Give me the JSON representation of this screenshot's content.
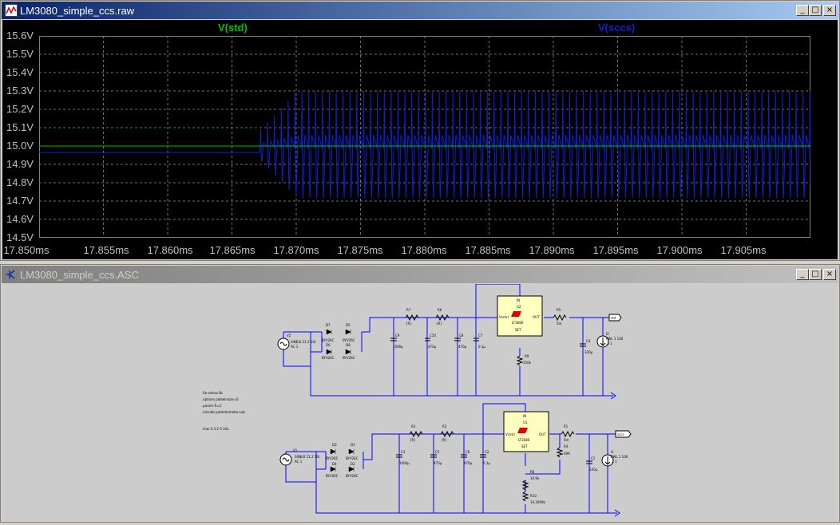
{
  "waveform_window": {
    "title": "LM3080_simple_ccs.raw",
    "traces": [
      {
        "name": "V(std)",
        "color": "#00c000"
      },
      {
        "name": "V(sccs)",
        "color": "#1020d0"
      }
    ],
    "y_ticks": [
      "15.6V",
      "15.5V",
      "15.4V",
      "15.3V",
      "15.2V",
      "15.1V",
      "15.0V",
      "14.9V",
      "14.8V",
      "14.7V",
      "14.6V",
      "14.5V"
    ],
    "x_ticks": [
      "17.850ms",
      "17.855ms",
      "17.860ms",
      "17.865ms",
      "17.870ms",
      "17.875ms",
      "17.880ms",
      "17.885ms",
      "17.890ms",
      "17.895ms",
      "17.900ms",
      "17.905ms"
    ]
  },
  "schematic_window": {
    "title": "LM3080_simple_ccs.ASC",
    "directives": [
      ".lib extras.lib",
      ".options plotwinsize=0",
      ".param R=2",
      ".include potentiometer.sub",
      ".tran 0 3.2 0 10u"
    ],
    "top": {
      "source": {
        "ref": "V2",
        "value1": "SINE(0 21.2 50)",
        "value2": "AC 1"
      },
      "diodes": [
        "D7",
        "D5",
        "D6",
        "D8"
      ],
      "diode_model": "BYV26C",
      "caps": [
        {
          "ref": "C9",
          "val": "1000µ"
        },
        {
          "ref": "C10",
          "val": "470µ"
        },
        {
          "ref": "C8",
          "val": "470µ"
        },
        {
          "ref": "C7",
          "val": "0.1µ"
        },
        {
          "ref": "C4",
          "val": "330µ"
        }
      ],
      "resistors": [
        {
          "ref": "R7",
          "val": "{R}"
        },
        {
          "ref": "R6",
          "val": "{R}"
        },
        {
          "ref": "R5",
          "val": "5m"
        },
        {
          "ref": "R9",
          "val": "150k"
        }
      ],
      "regulator": {
        "ref": "U2",
        "part": "LT3080",
        "pin_in": "IN",
        "pin_out": "OUT",
        "pin_vctrl": "Vcntrl",
        "pin_set": "SET"
      },
      "load": {
        "ref": "I2",
        "val": "PWL 1 100",
        "val2": ".3 1"
      },
      "net_label": "std"
    },
    "bottom": {
      "source": {
        "ref": "V1",
        "value1": "SINE(0 21.2 50)",
        "value2": "AC 1"
      },
      "diodes": [
        "D3",
        "D1",
        "D4",
        "D2"
      ],
      "diode_model": "BYV26C",
      "caps": [
        {
          "ref": "C3",
          "val": "1000µ"
        },
        {
          "ref": "C5",
          "val": "470µ"
        },
        {
          "ref": "C6",
          "val": "470µ"
        },
        {
          "ref": "C2",
          "val": "0.1µ"
        },
        {
          "ref": "C1",
          "val": "330µ"
        }
      ],
      "resistors": [
        {
          "ref": "R3",
          "val": "{R}"
        },
        {
          "ref": "R2",
          "val": "{R}"
        },
        {
          "ref": "R1",
          "val": "5m"
        },
        {
          "ref": "R4",
          "val": "499"
        },
        {
          "ref": "R8",
          "val": "10.9k"
        },
        {
          "ref": "R10",
          "val": "14.3009k"
        }
      ],
      "regulator": {
        "ref": "U1",
        "part": "LT3080",
        "pin_in": "IN",
        "pin_out": "OUT",
        "pin_vctrl": "Vcntrl",
        "pin_set": "SET"
      },
      "load": {
        "ref": "I1",
        "val": "PWL 1 100",
        "val2": ".3 1"
      },
      "net_label": "sccs"
    }
  },
  "window_buttons": {
    "minimize": "_",
    "restore": "□",
    "close": "×"
  },
  "colors": {
    "plot_bg": "#000000",
    "grid": "#808080",
    "schematic_bg": "#cccccc",
    "wire": "#0000ff",
    "component": "#000000",
    "regulator_fill": "#ffffc0",
    "titlebar_active": "#0a246a"
  }
}
